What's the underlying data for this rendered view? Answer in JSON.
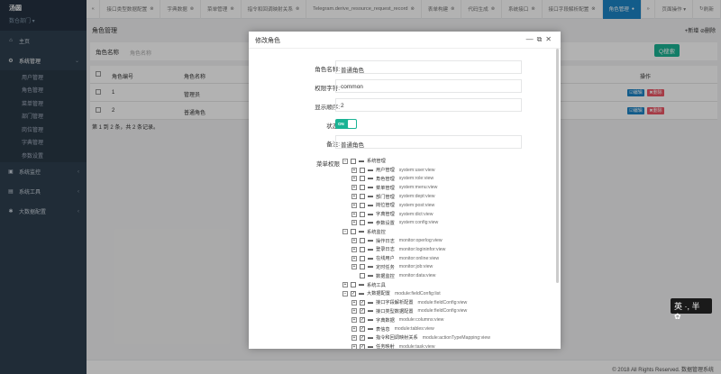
{
  "sidebar": {
    "user_name": "汤圆",
    "user_dept": "数仓部门 ▾",
    "items": [
      {
        "label": "主页"
      },
      {
        "label": "系统管理"
      },
      {
        "label": "系统监控"
      },
      {
        "label": "系统工具"
      },
      {
        "label": "大数据配置"
      }
    ],
    "sub_items": [
      "用户管理",
      "角色管理",
      "菜单管理",
      "部门管理",
      "岗位管理",
      "字典管理",
      "参数设置"
    ]
  },
  "tabs": [
    {
      "label": "接口类型数据配置"
    },
    {
      "label": "字典数据"
    },
    {
      "label": "菜单管理"
    },
    {
      "label": "指令和回调映射关系"
    },
    {
      "label": "Telegram.derive_resource_request_record"
    },
    {
      "label": "表单构建"
    },
    {
      "label": "代码生成"
    },
    {
      "label": "系统接口"
    },
    {
      "label": "接口字段解析配置"
    },
    {
      "label": "角色管理"
    }
  ],
  "topbar_right": {
    "page_ops": "页面操作 ▾",
    "refresh": "刷新"
  },
  "main": {
    "title": "角色管理",
    "add": "+新增",
    "delete": "⊘删除",
    "search_label": "角色名称",
    "search_placeholder": "角色名称",
    "search_btn": "Q搜索",
    "columns": [
      "角色编号",
      "角色名称",
      "操作"
    ],
    "rows": [
      {
        "id": "1",
        "name": "管理员"
      },
      {
        "id": "2",
        "name": "普通角色"
      }
    ],
    "edit_label": "☑编辑",
    "del_label": "✖删除",
    "page_info": "第 1 到 2 条，共 2 条记录。"
  },
  "footer": "© 2018 All Rights Reserved. 数据管理系统",
  "modal": {
    "title": "修改角色",
    "fields": [
      {
        "label": "角色名称:",
        "value": "普通角色"
      },
      {
        "label": "权限字符:",
        "value": "common"
      },
      {
        "label": "显示顺序:",
        "value": "2"
      }
    ],
    "status_label": "状态:",
    "status_value": "ON",
    "remark_label": "备注:",
    "remark_value": "普通角色",
    "menu_label": "菜单权限",
    "tree": [
      {
        "level": 0,
        "exp": "−",
        "checked": false,
        "name": "系统管理",
        "perm": ""
      },
      {
        "level": 1,
        "exp": "+",
        "checked": false,
        "name": "用户管理",
        "perm": "system:user:view"
      },
      {
        "level": 1,
        "exp": "+",
        "checked": false,
        "name": "角色管理",
        "perm": "system:role:view"
      },
      {
        "level": 1,
        "exp": "+",
        "checked": false,
        "name": "菜单管理",
        "perm": "system:menu:view"
      },
      {
        "level": 1,
        "exp": "+",
        "checked": false,
        "name": "部门管理",
        "perm": "system:dept:view"
      },
      {
        "level": 1,
        "exp": "+",
        "checked": false,
        "name": "岗位管理",
        "perm": "system:post:view"
      },
      {
        "level": 1,
        "exp": "+",
        "checked": false,
        "name": "字典管理",
        "perm": "system:dict:view"
      },
      {
        "level": 1,
        "exp": "+",
        "checked": false,
        "name": "参数设置",
        "perm": "system:config:view"
      },
      {
        "level": 0,
        "exp": "−",
        "checked": false,
        "name": "系统监控",
        "perm": ""
      },
      {
        "level": 1,
        "exp": "+",
        "checked": false,
        "name": "操作日志",
        "perm": "monitor:operlog:view"
      },
      {
        "level": 1,
        "exp": "+",
        "checked": false,
        "name": "登录日志",
        "perm": "monitor:logininfor:view"
      },
      {
        "level": 1,
        "exp": "+",
        "checked": false,
        "name": "在线用户",
        "perm": "monitor:online:view"
      },
      {
        "level": 1,
        "exp": "+",
        "checked": false,
        "name": "定时任务",
        "perm": "monitor:job:view"
      },
      {
        "level": 1,
        "exp": "",
        "checked": false,
        "name": "数据监控",
        "perm": "monitor:data:view"
      },
      {
        "level": 0,
        "exp": "+",
        "checked": false,
        "name": "系统工具",
        "perm": ""
      },
      {
        "level": 0,
        "exp": "−",
        "checked": true,
        "name": "大数据配置",
        "perm": "module:fieldConfig:list"
      },
      {
        "level": 1,
        "exp": "+",
        "checked": true,
        "name": "接口字段解析配置",
        "perm": "module:fieldConfig:view"
      },
      {
        "level": 1,
        "exp": "+",
        "checked": true,
        "name": "接口类型数据配置",
        "perm": "module:fieldConfig:view"
      },
      {
        "level": 1,
        "exp": "+",
        "checked": true,
        "name": "字典数据",
        "perm": "module:columns:view"
      },
      {
        "level": 1,
        "exp": "+",
        "checked": true,
        "name": "表信息",
        "perm": "module:tables:view"
      },
      {
        "level": 1,
        "exp": "+",
        "checked": true,
        "name": "指令和回调映射关系",
        "perm": "module:actionTypeMapping:view"
      },
      {
        "level": 1,
        "exp": "+",
        "checked": true,
        "name": "任务映射",
        "perm": "module:task:view"
      }
    ]
  },
  "ime": "英 ·, 半 ✿"
}
